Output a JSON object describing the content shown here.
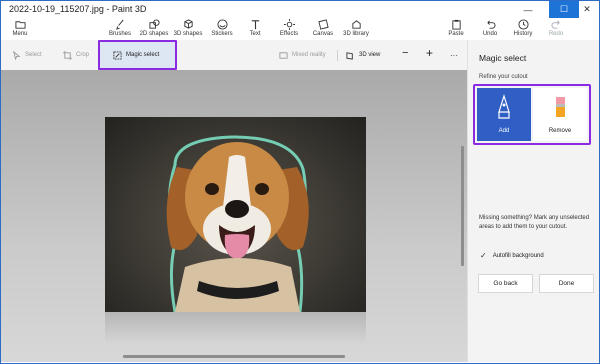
{
  "window": {
    "title": "2022-10-19_115207.jpg - Paint 3D"
  },
  "ribbon": {
    "menu": "Menu",
    "items": [
      "Brushes",
      "2D shapes",
      "3D shapes",
      "Stickers",
      "Text",
      "Effects",
      "Canvas",
      "3D library"
    ],
    "right_items": [
      "Paste",
      "Undo",
      "History",
      "Redo"
    ]
  },
  "toolbar": {
    "select": "Select",
    "crop": "Crop",
    "magic_select": "Magic select",
    "mixed_reality": "Mixed reality",
    "view_3d": "3D view",
    "zoom_out": "−",
    "zoom_in": "+",
    "more": "···"
  },
  "panel": {
    "title": "Magic select",
    "subtitle": "Refine your cutout",
    "add_label": "Add",
    "remove_label": "Remove",
    "help_text": "Missing something? Mark any unselected areas to add them to your cutout.",
    "autofill_label": "Autofill background",
    "go_back_label": "Go back",
    "done_label": "Done"
  },
  "colors": {
    "accent": "#2f5fc4",
    "highlight": "#8a2be2"
  }
}
